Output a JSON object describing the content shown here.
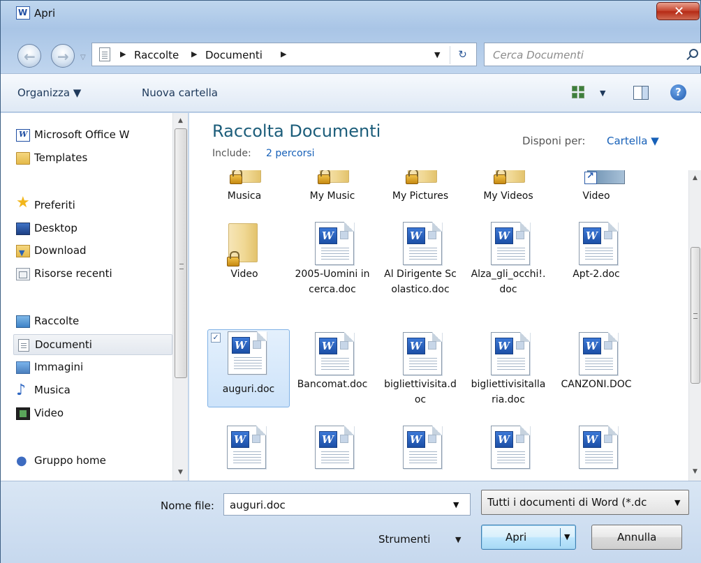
{
  "window": {
    "title": "Apri"
  },
  "nav": {
    "breadcrumb": [
      "Raccolte",
      "Documenti"
    ],
    "search_placeholder": "Cerca Documenti"
  },
  "toolbar": {
    "organize": "Organizza ▼",
    "new_folder": "Nuova cartella"
  },
  "sidebar": {
    "office_label": "Microsoft Office W",
    "templates": "Templates",
    "favorites_header": "Preferiti",
    "desktop": "Desktop",
    "download": "Download",
    "recent": "Risorse recenti",
    "libraries_header": "Raccolte",
    "documents": "Documenti",
    "pictures": "Immagini",
    "music": "Musica",
    "video": "Video",
    "homegroup": "Gruppo home"
  },
  "content": {
    "library_title": "Raccolta Documenti",
    "include_label": "Include:",
    "include_link": "2 percorsi",
    "arrange_label": "Disponi per:",
    "arrange_value": "Cartella ▼",
    "items": [
      "Musica",
      "My Music",
      "My Pictures",
      "My Videos",
      "Video",
      "Video",
      "2005-Uomini in cerca.doc",
      "Al Dirigente Scolastico.doc",
      "Alza_gli_occhi!.doc",
      "Apt-2.doc",
      "auguri.doc",
      "Bancomat.doc",
      "bigliettivisita.doc",
      "bigliettivisitallaria.doc",
      "CANZONI.DOC"
    ]
  },
  "footer": {
    "filename_label": "Nome file:",
    "filename_value": "auguri.doc",
    "filetype_value": "Tutti i documenti di Word (*.dc",
    "tools": "Strumenti",
    "open": "Apri",
    "cancel": "Annulla"
  },
  "colors": {
    "accent": "#1660b8",
    "title": "#1c5d7a",
    "selection": "#cde3fa"
  }
}
